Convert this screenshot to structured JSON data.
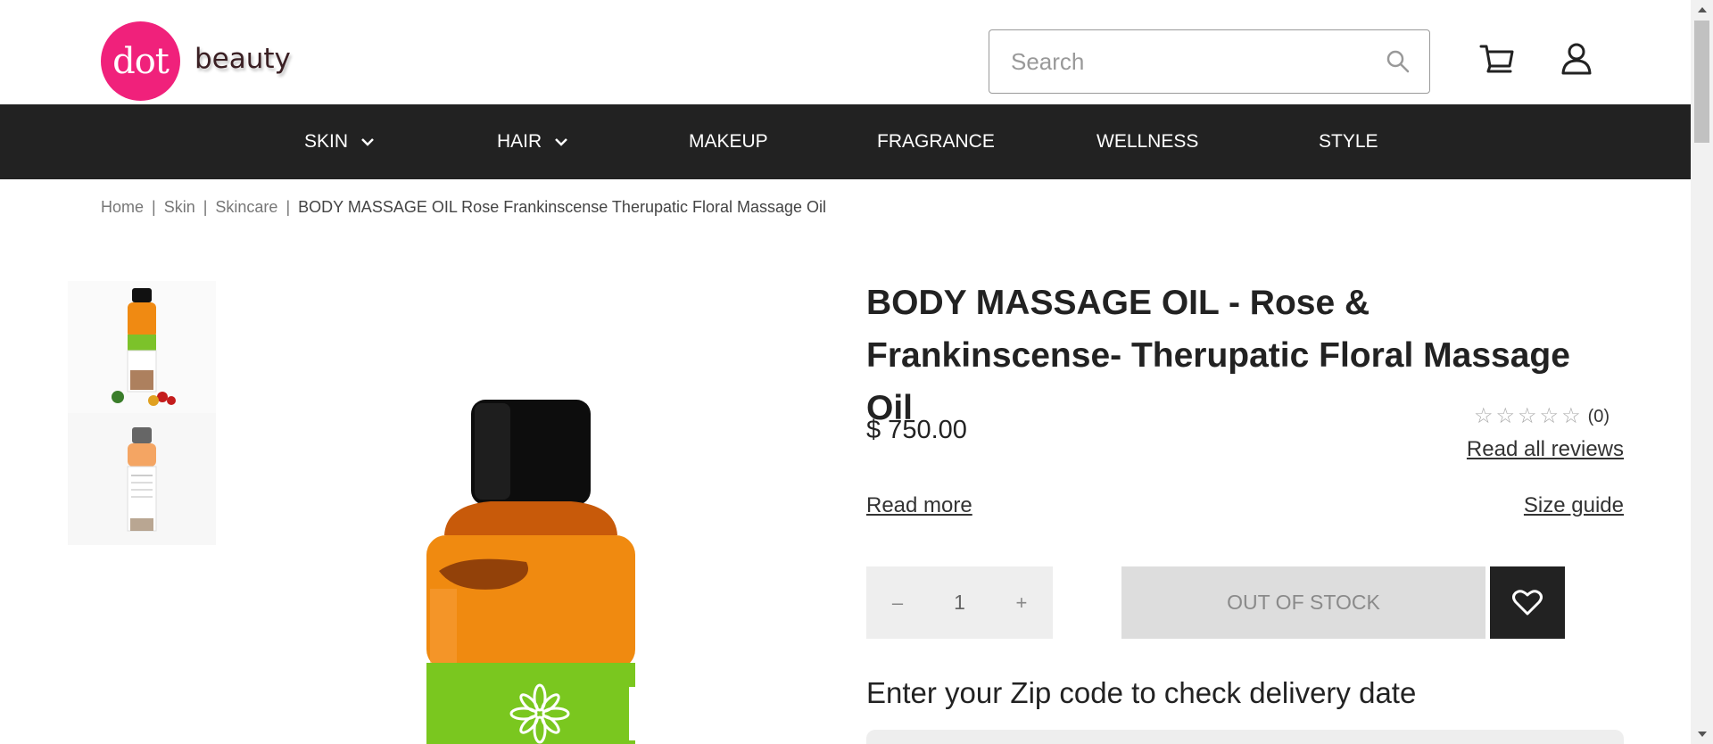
{
  "header": {
    "logo_mark": "dot",
    "logo_text": "beauty",
    "search_placeholder": "Search",
    "brand_color": "#f0217b"
  },
  "nav": {
    "items": [
      {
        "label": "SKIN",
        "has_dropdown": true
      },
      {
        "label": "HAIR",
        "has_dropdown": true
      },
      {
        "label": "MAKEUP",
        "has_dropdown": false
      },
      {
        "label": "FRAGRANCE",
        "has_dropdown": false
      },
      {
        "label": "WELLNESS",
        "has_dropdown": false
      },
      {
        "label": "STYLE",
        "has_dropdown": false
      }
    ]
  },
  "breadcrumb": {
    "items": [
      "Home",
      "Skin",
      "Skincare"
    ],
    "current": "BODY MASSAGE OIL Rose Frankinscense Therupatic Floral Massage Oil"
  },
  "product": {
    "title": "BODY MASSAGE OIL - Rose & Frankinscense- Therupatic Floral Massage Oil",
    "price": "$ 750.00",
    "rating_stars": 0,
    "rating_count": "(0)",
    "read_reviews": "Read all reviews",
    "read_more": "Read more",
    "size_guide": "Size guide",
    "quantity": "1",
    "qty_minus": "–",
    "qty_plus": "+",
    "stock_button": "OUT OF STOCK",
    "zip_heading": "Enter your Zip code to check delivery date"
  }
}
